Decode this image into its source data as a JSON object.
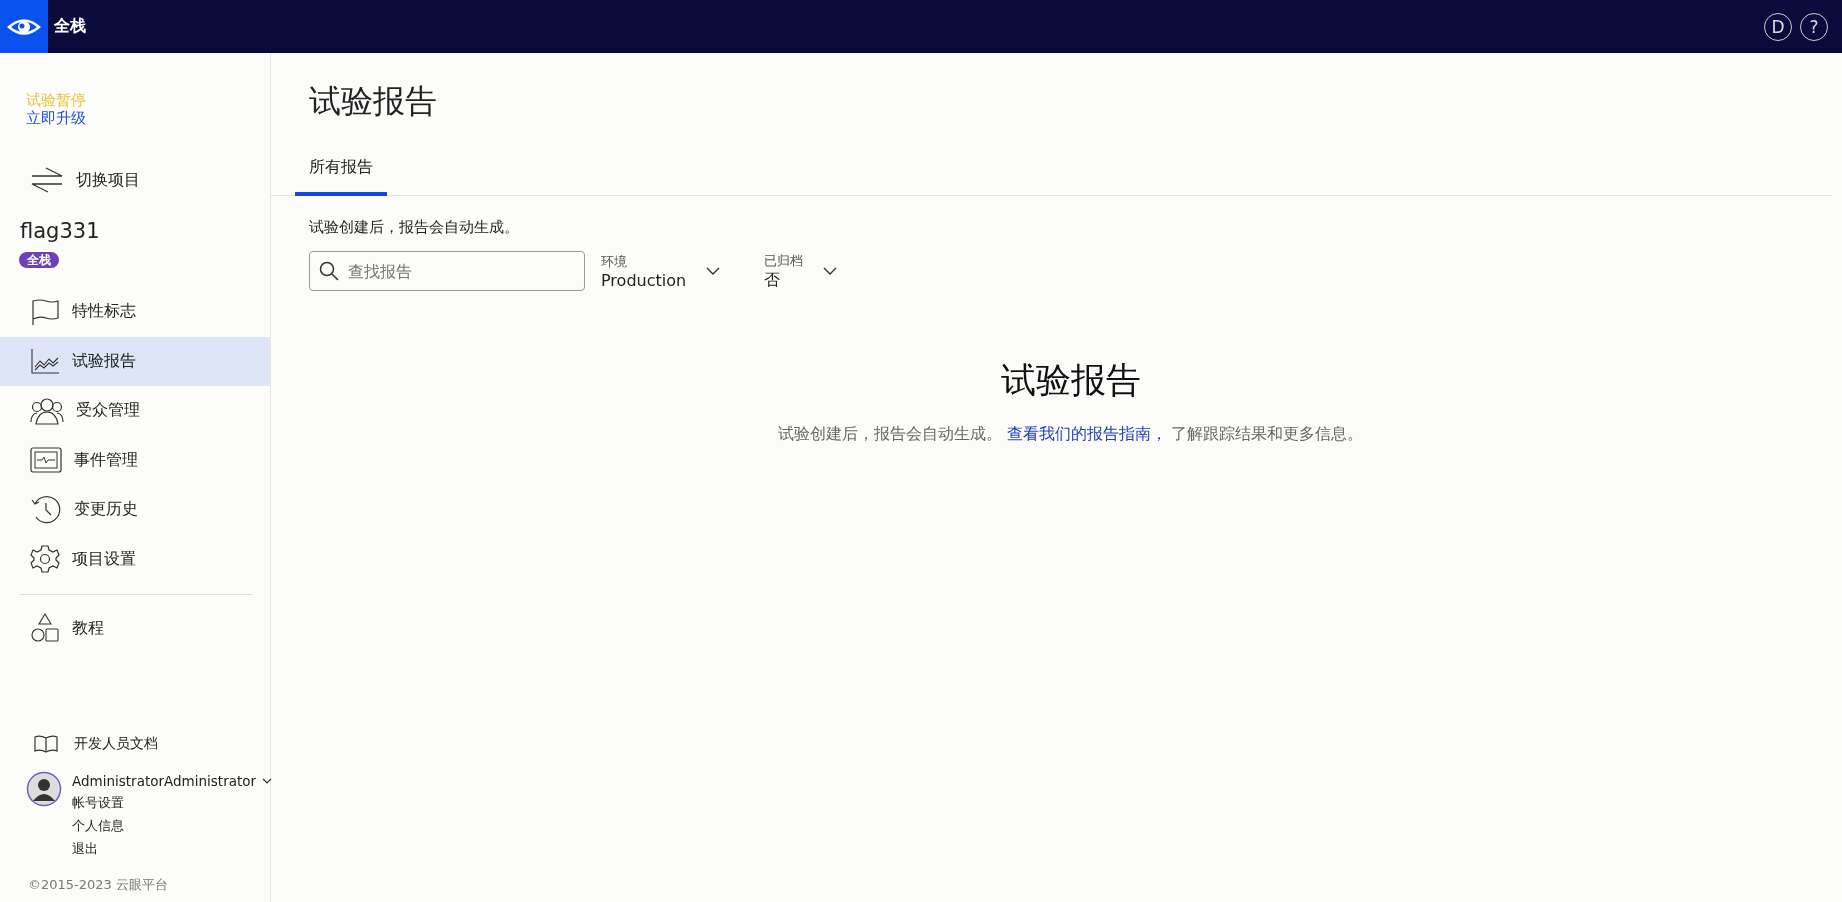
{
  "top_bar": {
    "brand": "全栈",
    "user_initial": "D",
    "help": "?"
  },
  "sidebar": {
    "trial_status": "试验暂停",
    "upgrade_link": "立即升级",
    "switch_project": "切换项目",
    "project_name": "flag331",
    "project_badge": "全栈",
    "items": [
      {
        "kind": "flag",
        "label": "特性标志",
        "selected": false
      },
      {
        "kind": "chart",
        "label": "试验报告",
        "selected": true
      },
      {
        "kind": "people",
        "label": "受众管理",
        "selected": false
      },
      {
        "kind": "monitor",
        "label": "事件管理",
        "selected": false
      },
      {
        "kind": "history",
        "label": "变更历史",
        "selected": false
      },
      {
        "kind": "gear",
        "label": "项目设置",
        "selected": false
      }
    ],
    "tutorial": "教程",
    "docs": "开发人员文档",
    "user": {
      "name": "AdministratorAdministrator",
      "menu": [
        "帐号设置",
        "个人信息",
        "退出"
      ]
    },
    "copyright": "©2015-2023 云眼平台"
  },
  "main": {
    "title": "试验报告",
    "tabs": [
      {
        "label": "所有报告",
        "selected": true
      }
    ],
    "description": "试验创建后，报告会自动生成。",
    "search": {
      "placeholder": "查找报告"
    },
    "filters": [
      {
        "label": "环境",
        "value": "Production"
      },
      {
        "label": "已归档",
        "value": "否"
      }
    ],
    "empty_state": {
      "title": "试验报告",
      "text_before": "试验创建后，报告会自动生成。",
      "link": "查看我们的报告指南，",
      "text_after": "了解跟踪结果和更多信息。"
    }
  }
}
